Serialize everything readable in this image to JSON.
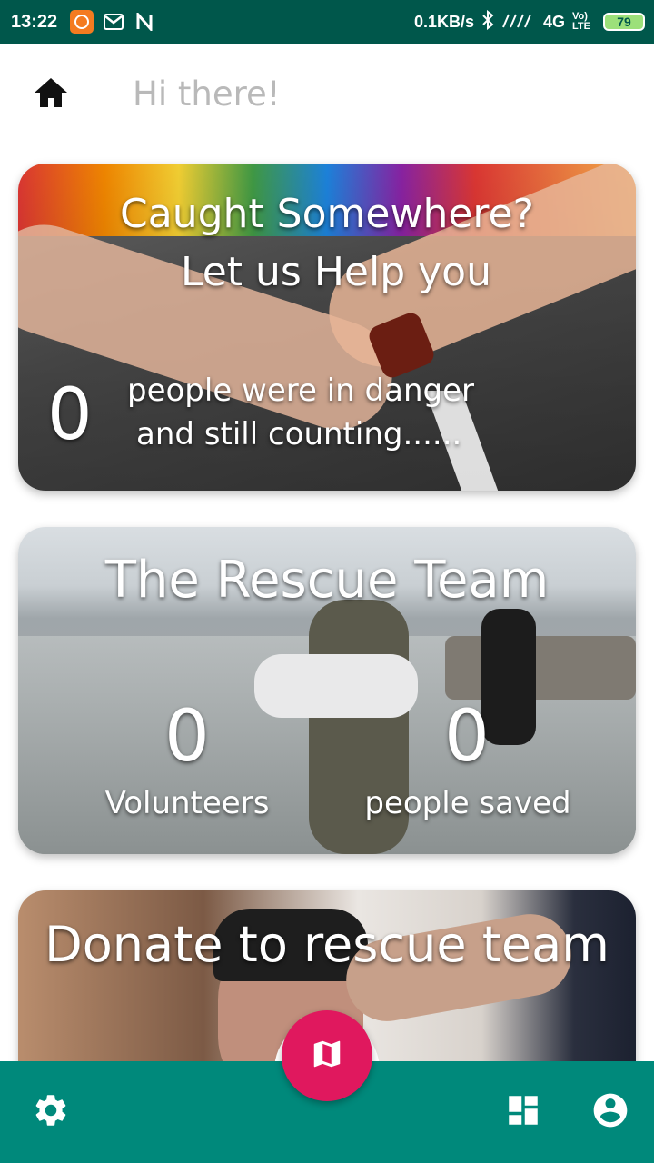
{
  "status_bar": {
    "time": "13:22",
    "network_speed": "0.1KB/s",
    "network_type": "4G",
    "volte": "Vo) LTE",
    "battery": "79",
    "bg_color": "#00574B"
  },
  "header": {
    "greeting": "Hi there!",
    "home_icon": "home-icon"
  },
  "cards": {
    "help": {
      "title_line1": "Caught Somewhere?",
      "title_line2": "Let us Help you",
      "count": "0",
      "desc_line1": "people were in danger",
      "desc_line2": "and still counting......"
    },
    "team": {
      "title": "The Rescue Team",
      "volunteers_count": "0",
      "volunteers_label": "Volunteers",
      "saved_count": "0",
      "saved_label": "people saved"
    },
    "donate": {
      "title": "Donate to rescue team"
    }
  },
  "bottom_nav": {
    "bg_color": "#00897B",
    "fab_color": "#E0185E",
    "settings_icon": "gear-icon",
    "map_icon": "map-icon",
    "dashboard_icon": "dashboard-icon",
    "profile_icon": "account-icon"
  }
}
